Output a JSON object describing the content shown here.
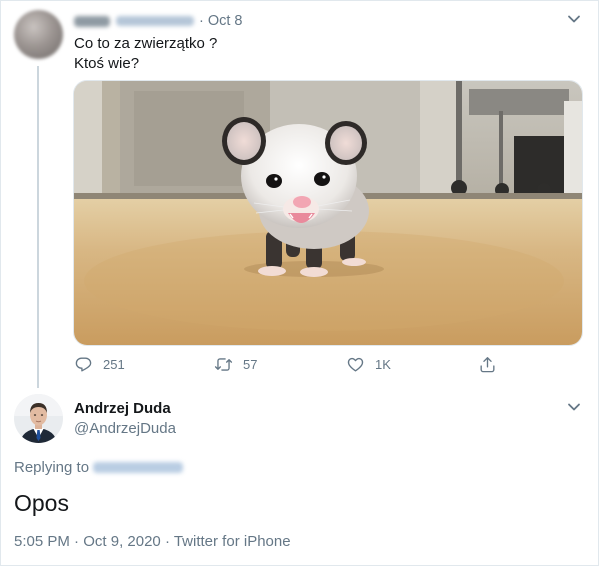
{
  "original_tweet": {
    "date_separator": "·",
    "date": "Oct 8",
    "text": "Co to za zwierzątko ?\nKtoś wie?",
    "image_icon": "opossum-photo",
    "actions": {
      "reply_count": "251",
      "retweet_count": "57",
      "like_count": "1K"
    }
  },
  "reply_tweet": {
    "display_name": "Andrzej Duda",
    "handle": "@AndrzejDuda",
    "replying_to_label": "Replying to",
    "text": "Opos",
    "time": "5:05 PM",
    "date": "Oct 9, 2020",
    "source": "Twitter for iPhone",
    "meta_separator": " · "
  },
  "colors": {
    "secondary_text": "#657786",
    "primary_text": "#14171a",
    "link_blue": "#1da1f2",
    "divider": "#e1e8ed"
  },
  "icons": [
    "chevron-down-icon",
    "reply-icon",
    "retweet-icon",
    "heart-icon",
    "share-icon"
  ]
}
